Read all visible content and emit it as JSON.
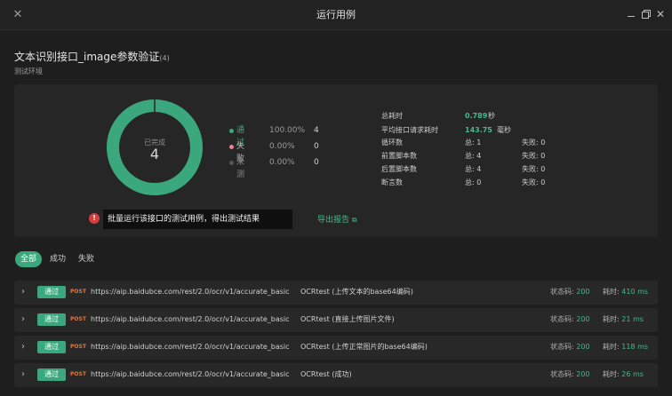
{
  "window": {
    "title": "运行用例",
    "close_glyph": "✕",
    "window_close_glyph": "✕",
    "icons": [
      "close-icon",
      "minimize-icon",
      "restore-icon",
      "window-close-icon"
    ]
  },
  "header": {
    "title": "文本识别接口_image参数验证",
    "count": "(4)",
    "env": "测试环境"
  },
  "summary": {
    "center_label": "已完成",
    "center_value": "4",
    "legend": [
      {
        "name": "通过",
        "pct": "100.00%",
        "count": "4",
        "color": "#3aa87c",
        "fraction": 1.0
      },
      {
        "name": "失败",
        "pct": "0.00%",
        "count": "0",
        "color": "#e8838f",
        "fraction": 0.0
      },
      {
        "name": "未测",
        "pct": "0.00%",
        "count": "0",
        "color": "#555555",
        "fraction": 0.0
      }
    ],
    "donut_color": "#3aa87c"
  },
  "stats": {
    "total_time_label": "总耗时",
    "total_time_value": "0.789",
    "total_time_unit": "秒",
    "avg_time_label": "平均接口请求耗时",
    "avg_time_value": "143.75",
    "avg_time_unit": "毫秒",
    "loops_label": "循环数",
    "loops_total": "总: 1",
    "loops_fail": "失败: 0",
    "pre_label": "前置脚本数",
    "pre_total": "总: 4",
    "pre_fail": "失败: 0",
    "post_label": "后置脚本数",
    "post_total": "总: 4",
    "post_fail": "失败: 0",
    "assert_label": "断言数",
    "assert_total": "总: 0",
    "assert_fail": "失败: 0"
  },
  "tooltip": {
    "icon": "!",
    "text": "批量运行该接口的测试用例，得出测试结果"
  },
  "export": {
    "label": "导出报告",
    "icon": "external-link-icon",
    "glyph": "⧉"
  },
  "tabs": [
    {
      "label": "全部",
      "active": true
    },
    {
      "label": "成功",
      "active": false
    },
    {
      "label": "失败",
      "active": false
    }
  ],
  "rows": [
    {
      "chevron": "›",
      "status": "通过",
      "method": "POST",
      "url": "https://aip.baidubce.com/rest/2.0/ocr/v1/accurate_basic",
      "name": "OCRtest (上传文本的base64编码)",
      "code_label": "状态码:",
      "code": "200",
      "time_label": "耗时:",
      "time": "410 ms"
    },
    {
      "chevron": "›",
      "status": "通过",
      "method": "POST",
      "url": "https://aip.baidubce.com/rest/2.0/ocr/v1/accurate_basic",
      "name": "OCRtest (直接上传图片文件)",
      "code_label": "状态码:",
      "code": "200",
      "time_label": "耗时:",
      "time": "21 ms"
    },
    {
      "chevron": "›",
      "status": "通过",
      "method": "POST",
      "url": "https://aip.baidubce.com/rest/2.0/ocr/v1/accurate_basic",
      "name": "OCRtest (上传正常图片的base64编码)",
      "code_label": "状态码:",
      "code": "200",
      "time_label": "耗时:",
      "time": "118 ms"
    },
    {
      "chevron": "›",
      "status": "通过",
      "method": "POST",
      "url": "https://aip.baidubce.com/rest/2.0/ocr/v1/accurate_basic",
      "name": "OCRtest (成功)",
      "code_label": "状态码:",
      "code": "200",
      "time_label": "耗时:",
      "time": "26 ms"
    }
  ]
}
